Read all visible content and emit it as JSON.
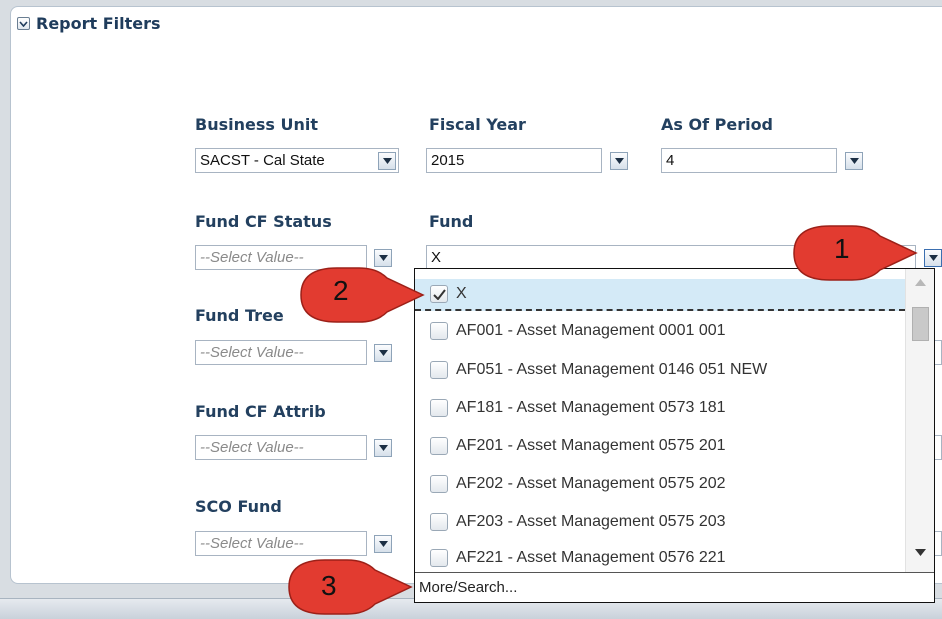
{
  "panel": {
    "title": "Report Filters"
  },
  "filters": {
    "business_unit": {
      "label": "Business Unit",
      "value": "SACST - Cal State"
    },
    "fiscal_year": {
      "label": "Fiscal Year",
      "value": "2015"
    },
    "as_of_period": {
      "label": "As Of Period",
      "value": "4"
    },
    "fund_cf_status": {
      "label": "Fund CF Status",
      "value": "--Select Value--"
    },
    "fund": {
      "label": "Fund",
      "value": "X"
    },
    "fund_tree": {
      "label": "Fund Tree",
      "value": "--Select Value--"
    },
    "fund_cf_attrib": {
      "label": "Fund CF Attrib",
      "value": "--Select Value--"
    },
    "sco_fund": {
      "label": "SCO Fund",
      "value": "--Select Value--"
    }
  },
  "dropdown": {
    "items": [
      {
        "label": "X",
        "checked": true
      },
      {
        "label": "AF001 - Asset Management 0001 001",
        "checked": false
      },
      {
        "label": "AF051 - Asset Management 0146 051 NEW",
        "checked": false
      },
      {
        "label": "AF181 - Asset Management 0573 181",
        "checked": false
      },
      {
        "label": "AF201 - Asset Management 0575 201",
        "checked": false
      },
      {
        "label": "AF202 - Asset Management 0575 202",
        "checked": false
      },
      {
        "label": "AF203 - Asset Management 0575 203",
        "checked": false
      },
      {
        "label": "AF221 - Asset Management 0576 221",
        "checked": false
      }
    ],
    "more_label": "More/Search..."
  },
  "callouts": [
    {
      "number": "1",
      "color": "#e23b30"
    },
    {
      "number": "2",
      "color": "#e23b30"
    },
    {
      "number": "3",
      "color": "#e23b30"
    }
  ]
}
